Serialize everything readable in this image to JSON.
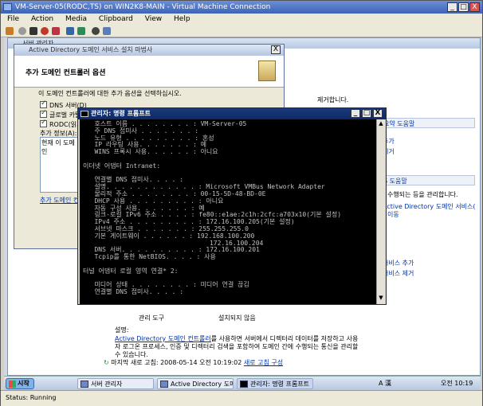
{
  "host": {
    "title": "VM-Server-05(RODC,TS) on WIN2K8-MAIN - Virtual Machine Connection",
    "menu": [
      "File",
      "Action",
      "Media",
      "Clipboard",
      "View",
      "Help"
    ],
    "min": "_",
    "max": "□",
    "close": "X",
    "status": "Status: Running"
  },
  "server_manager": {
    "title": "서버 관리자",
    "frag1": "제거합니다.",
    "section1_title": "요약 도움말",
    "section1_items": [
      "추가",
      "제거"
    ],
    "section2_title": "S 도움말",
    "section2_text": "수행되는 등을 관리합니다.",
    "section2_link1": "Active Directory 도메인 서비스(",
    "section2_link2": "이동",
    "section3_items": [
      "서비스 추가",
      "서비스 제거"
    ],
    "rows": [
      {
        "name": "관리 도구",
        "value": "설치되지 않음"
      }
    ],
    "desc_label": "설명:",
    "desc_link": "Active Directory 도메인 컨트롤러",
    "desc_text": "를 사용하면 서버에서 디렉터리 데이터를 저장하고 사용자 로그온 프로세스, 인증 및 디렉터리 검색을 포함하여 도메인 간에 수행되는 통신을 관리할 수 있습니다.",
    "refresh_text": "마지막 새로 고침: 2008-05-14 오전 10:19:02",
    "refresh_link": "새로 고침 구성"
  },
  "ad_wizard": {
    "title": "Active Directory 도메인 서비스 설치 마법사",
    "heading": "추가 도메인 컨트롤러 옵션",
    "prompt": "이 도메인 컨트롤러에 대한 추가 옵션을 선택하십시오.",
    "options": [
      {
        "label": "DNS 서버(D)",
        "checked": true
      },
      {
        "label": "글로벌 카탈",
        "checked": true
      },
      {
        "label": "RODC(읽기",
        "checked": true
      }
    ],
    "info_label": "추가 정보(A):",
    "info_text": "현재 이 도메인",
    "more_link": "추가 도메인 컨"
  },
  "cmd": {
    "title": "관리자: 명령 프롬프트",
    "lines": [
      "   호스트 이름 . . . . . . . . : VM-Server-05",
      "   주 DNS 접미사 . . . . . . . :",
      "   노드 유형 . . . . . . . . . : 혼성",
      "   IP 라우팅 사용. . . . . . . : 예",
      "   WINS 프록시 사용. . . . . . : 아니요",
      "",
      "이더넷 어댑터 Intranet:",
      "",
      "   연결별 DNS 접미사. . . . :",
      "   설명. . . . . . . . . . . . : Microsoft VMBus Network Adapter",
      "   물리적 주소 . . . . . . . . : 00-15-5D-48-BD-0E",
      "   DHCP 사용 . . . . . . . . . : 아니요",
      "   자동 구성 사용. . . . . . . : 예",
      "   링크-로컬 IPv6 주소 . . . . : fe80::e1ae:2c1h:2cfc:a703x10(기본 설정)",
      "   IPv4 주소 . . . . . . . . . : 172.16.100.205(기본 설정)",
      "   서브넷 마스크 . . . . . . . : 255.255.255.0",
      "   기본 게이트웨이 . . . . . . : 192.168.100.200",
      "                                 172.16.100.204",
      "   DNS 서버. . . . . . . . . . : 172.16.100.201",
      "   Tcpip를 통한 NetBIOS. . . . : 사용",
      "",
      "터널 어댑터 로컬 영역 연결* 2:",
      "",
      "   미디어 상태 . . . . . . . . : 미디어 연결 끊김",
      "   연결별 DNS 접미사. . . . :"
    ]
  },
  "taskbar": {
    "start": "시작",
    "items": [
      "서버 관리자",
      "Active Directory 도메...",
      "관리자: 명령 프롬프트"
    ],
    "lang": "A 漢",
    "clock": "오전 10:19"
  }
}
